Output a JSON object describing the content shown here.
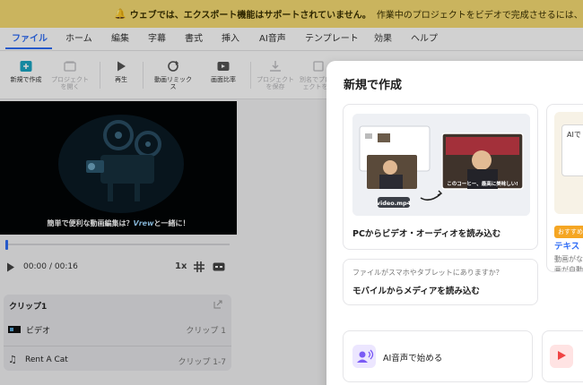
{
  "banner": {
    "strong": "ウェブでは、エクスポート機能はサポートされていません。",
    "rest": "作業中のプロジェクトをビデオで完成させるには、ア"
  },
  "menu": {
    "items": [
      {
        "label": "ファイル",
        "active": true
      },
      {
        "label": "ホーム"
      },
      {
        "label": "編集"
      },
      {
        "label": "字幕"
      },
      {
        "label": "書式"
      },
      {
        "label": "挿入"
      },
      {
        "label": "AI音声"
      },
      {
        "label": "テンプレート"
      },
      {
        "label": "効果"
      },
      {
        "label": "ヘルプ"
      }
    ]
  },
  "toolbar": {
    "new_l1": "新規で作成",
    "open_l1": "プロジェクト",
    "open_l2": "を開く",
    "play_l1": "再生",
    "remix_l1": "動画リミック",
    "remix_l2": "ス",
    "ratio_l1": "画面比率",
    "save_l1": "プロジェクト",
    "save_l2": "を保存",
    "saveas_l1": "別名でプロジ",
    "saveas_l2": "ェクトを保"
  },
  "player": {
    "caption_before": "簡単で便利な動画編集は？",
    "caption_brand": "Vrew",
    "caption_after": "と一緒に！",
    "current_time": "00:00",
    "total_time": "/ 00:16",
    "speed": "1x"
  },
  "clips": {
    "title": "クリップ1",
    "rows": [
      {
        "label": "ビデオ",
        "value": "クリップ 1"
      },
      {
        "label": "Rent A Cat",
        "value": "クリップ 1-7"
      }
    ]
  },
  "modal": {
    "title": "新規で作成",
    "pc_import": "PCからビデオ・オーディオを読み込む",
    "illus_file": "video.mp4",
    "illus_sub": "このコーヒー、最高に美味しい!",
    "mobile_hint": "ファイルがスマホやタブレットにありますか？",
    "mobile_import": "モバイルからメディアを読み込む",
    "ai_voice": "AI音声で始める",
    "text_badge": "おすすめ",
    "text_title": "テキス",
    "text_desc1": "動画がな",
    "text_desc2": "画が自動",
    "ai_card_text": "AIで"
  },
  "colors": {
    "accent": "#2f6df6",
    "banner_bg": "#f7dc73",
    "badge": "#f5a623"
  }
}
